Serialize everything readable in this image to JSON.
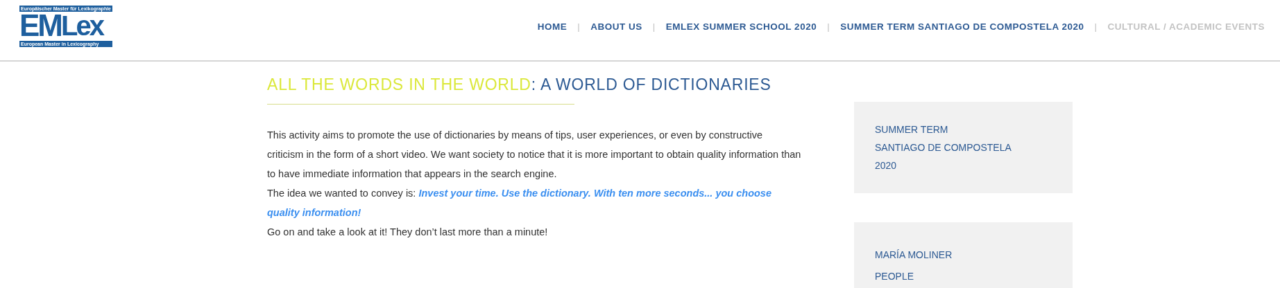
{
  "logo": {
    "tagline": "Europäischer Master für Lexikographie",
    "letters_first": "EM",
    "letters_rest": "Lex",
    "subtitle": "European Master in Lexicography"
  },
  "nav": [
    {
      "label": "HOME",
      "selected": false
    },
    {
      "label": "ABOUT US",
      "selected": false
    },
    {
      "label": "EMLEX SUMMER SCHOOL 2020",
      "selected": false
    },
    {
      "label": "SUMMER TERM SANTIAGO DE COMPOSTELA 2020",
      "selected": false
    },
    {
      "label": "CULTURAL / ACADEMIC EVENTS",
      "selected": true
    }
  ],
  "nav_separator": "|",
  "article": {
    "title_highlight": "ALL THE WORDS IN THE WORLD",
    "title_rest": ": A WORLD OF DICTIONARIES",
    "paragraphs": [
      {
        "text": "This activity aims to promote the use of dictionaries by means of tips, user experiences, or even by constructive criticism in the form of a short video. We want society to notice that it is more important to obtain quality information than to have immediate information that appears in the search engine."
      },
      {
        "text": "The idea we wanted to convey is: ",
        "emphasis": "Invest your time. Use the dictionary. With ten more seconds... you choose quality information!"
      },
      {
        "text": "Go on and take a look at it! They don’t last more than a minute!"
      }
    ]
  },
  "sidebar": [
    {
      "links": [
        {
          "label": "SUMMER TERM"
        },
        {
          "label": "SANTIAGO DE COMPOSTELA"
        },
        {
          "label": "2020"
        }
      ]
    },
    {
      "links": [
        {
          "label": "MARÍA MOLINER"
        },
        {
          "label": "PEOPLE"
        }
      ]
    }
  ]
}
